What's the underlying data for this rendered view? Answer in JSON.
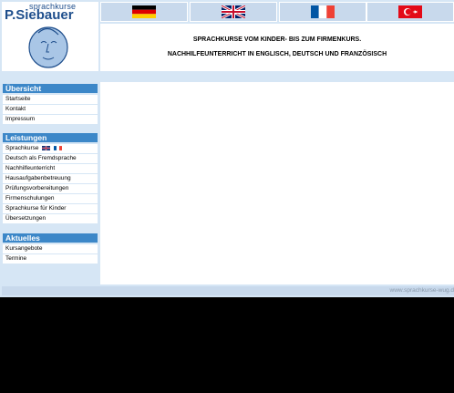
{
  "logo": {
    "top_text": "sprachkurse",
    "wordmark": "P.Siebauer"
  },
  "flags": [
    {
      "name": "german-flag-icon"
    },
    {
      "name": "uk-flag-icon"
    },
    {
      "name": "french-flag-icon"
    },
    {
      "name": "turkish-flag-icon"
    }
  ],
  "headline": {
    "line1": "SPRACHKURSE VOM KINDER- BIS ZUM FIRMENKURS.",
    "line2": "NACHHILFEUNTERRICHT IN ENGLISCH, DEUTSCH UND FRANZÖSISCH"
  },
  "sidebar": {
    "uebersicht": {
      "heading": "Übersicht",
      "items": [
        "Startseite",
        "Kontakt",
        "Impressum"
      ]
    },
    "leistungen": {
      "heading": "Leistungen",
      "items": [
        "Sprachkurse",
        "Deutsch als Fremdsprache",
        "Nachhilfeunterricht",
        "Hausaufgabenbetreuung",
        "Prüfungsvorbereitungen",
        "Firmenschulungen",
        "Sprachkurse für Kinder",
        "Übersetzungen"
      ]
    },
    "aktuelles": {
      "heading": "Aktuelles",
      "items": [
        "Kursangebote",
        "Termine"
      ]
    }
  },
  "footer": {
    "url": "www.sprachkurse-wug.d"
  },
  "colors": {
    "section_header": "#3c87c8",
    "background": "#d6e6f5",
    "flag_cell": "#c8d9ec"
  }
}
